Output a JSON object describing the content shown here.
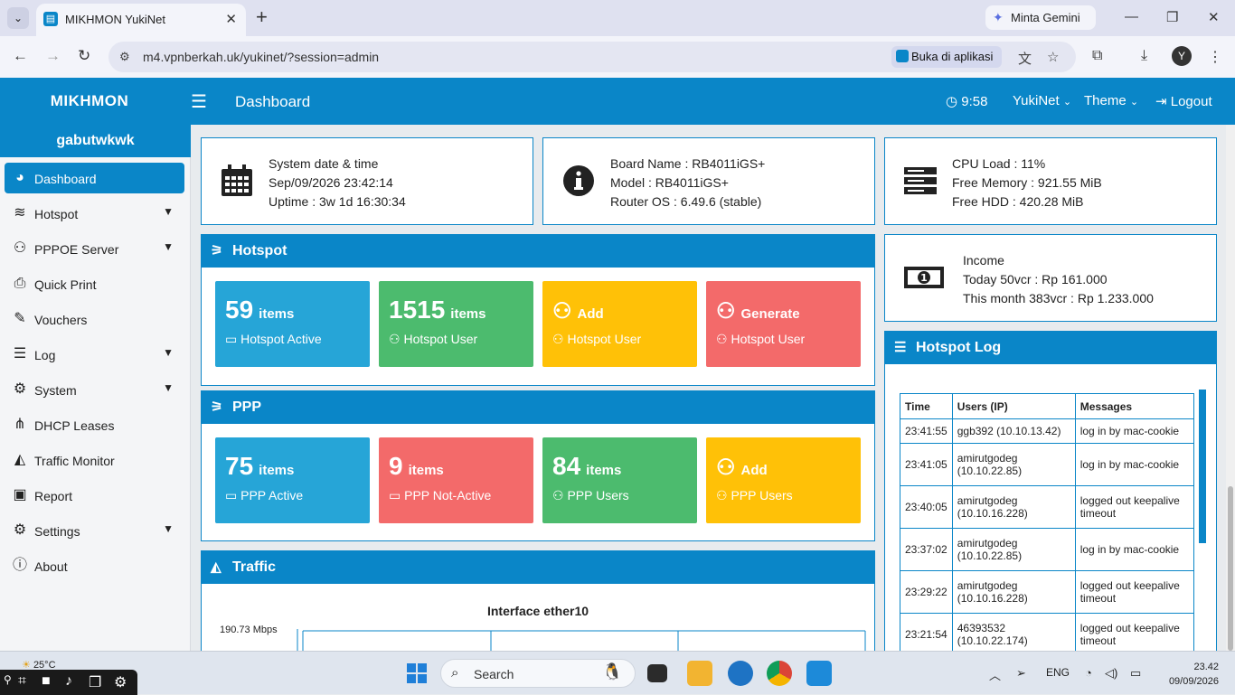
{
  "browser": {
    "tab_title": "MIKHMON YukiNet",
    "new_tab": "+",
    "gemini_label": "Minta Gemini",
    "url": "m4.vpnberkah.uk/yukinet/?session=admin",
    "open_app_label": "Buka di aplikasi",
    "profile_initial": "Y"
  },
  "header": {
    "brand": "MIKHMON",
    "page_title": "Dashboard",
    "time": "9:58",
    "site": "YukiNet",
    "theme": "Theme",
    "logout": "Logout"
  },
  "sidebar": {
    "user": "gabutwkwk",
    "items": [
      {
        "label": "Dashboard",
        "icon": "dashboard-icon",
        "active": true,
        "caret": false
      },
      {
        "label": "Hotspot",
        "icon": "wifi-icon",
        "caret": true
      },
      {
        "label": "PPPOE Server",
        "icon": "users-icon",
        "caret": true
      },
      {
        "label": "Quick Print",
        "icon": "print-icon",
        "caret": false
      },
      {
        "label": "Vouchers",
        "icon": "ticket-icon",
        "caret": false
      },
      {
        "label": "Log",
        "icon": "list-icon",
        "caret": true
      },
      {
        "label": "System",
        "icon": "gear-icon",
        "caret": true
      },
      {
        "label": "DHCP Leases",
        "icon": "sitemap-icon",
        "caret": false
      },
      {
        "label": "Traffic Monitor",
        "icon": "area-chart-icon",
        "caret": false
      },
      {
        "label": "Report",
        "icon": "money-icon",
        "caret": false
      },
      {
        "label": "Settings",
        "icon": "gear-icon",
        "caret": true
      },
      {
        "label": "About",
        "icon": "info-icon",
        "caret": false
      }
    ]
  },
  "system_card": {
    "line1": "System date & time",
    "line2": "Sep/09/2026 23:42:14",
    "line3": "Uptime : 3w 1d 16:30:34"
  },
  "board_card": {
    "line1": "Board Name : RB4011iGS+",
    "line2": "Model : RB4011iGS+",
    "line3": "Router OS : 6.49.6 (stable)"
  },
  "resource_card": {
    "line1": "CPU Load : 11%",
    "line2": "Free Memory : 921.55 MiB",
    "line3": "Free HDD : 420.28 MiB"
  },
  "income_card": {
    "line1": "Income",
    "line2": "Today 50vcr : Rp 161.000",
    "line3": "This month 383vcr : Rp 1.233.000"
  },
  "hotspot_panel": {
    "title": "Hotspot",
    "tiles": [
      {
        "big": "59",
        "unit": "items",
        "sub": "Hotspot Active",
        "color": "#26a5d7"
      },
      {
        "big": "1515",
        "unit": "items",
        "sub": "Hotspot User",
        "color": "#4cbb6e"
      },
      {
        "big": "",
        "unit": "Add",
        "sub": "Hotspot User",
        "color": "#ffc107"
      },
      {
        "big": "",
        "unit": "Generate",
        "sub": "Hotspot User",
        "color": "#f36a6a"
      }
    ]
  },
  "ppp_panel": {
    "title": "PPP",
    "tiles": [
      {
        "big": "75",
        "unit": "items",
        "sub": "PPP Active",
        "color": "#26a5d7"
      },
      {
        "big": "9",
        "unit": "items",
        "sub": "PPP Not-Active",
        "color": "#f36a6a"
      },
      {
        "big": "84",
        "unit": "items",
        "sub": "PPP Users",
        "color": "#4cbb6e"
      },
      {
        "big": "",
        "unit": "Add",
        "sub": "PPP Users",
        "color": "#ffc107"
      }
    ]
  },
  "traffic_panel": {
    "title": "Traffic",
    "chart_title": "Interface ether10",
    "y_top_label": "190.73 Mbps"
  },
  "hotspot_log": {
    "title": "Hotspot Log",
    "columns": [
      "Time",
      "Users (IP)",
      "Messages"
    ],
    "rows": [
      {
        "time": "23:41:55",
        "user": "ggb392 (10.10.13.42)",
        "msg": "log in by mac-cookie"
      },
      {
        "time": "23:41:05",
        "user": "amirutgodeg (10.10.22.85)",
        "msg": "log in by mac-cookie"
      },
      {
        "time": "23:40:05",
        "user": "amirutgodeg (10.10.16.228)",
        "msg": "logged out keepalive timeout"
      },
      {
        "time": "23:37:02",
        "user": "amirutgodeg (10.10.22.85)",
        "msg": "log in by mac-cookie"
      },
      {
        "time": "23:29:22",
        "user": "amirutgodeg (10.10.16.228)",
        "msg": "logged out keepalive timeout"
      },
      {
        "time": "23:21:54",
        "user": "46393532 (10.10.22.174)",
        "msg": "logged out keepalive timeout"
      }
    ]
  },
  "taskbar": {
    "weather": "25°C",
    "search_label": "Search",
    "lang": "ENG",
    "time": "23.42",
    "date": "09/09/2026"
  },
  "colors": {
    "primary": "#0a86c8",
    "blue_tile": "#26a5d7",
    "green_tile": "#4cbb6e",
    "yellow_tile": "#ffc107",
    "red_tile": "#f36a6a"
  }
}
